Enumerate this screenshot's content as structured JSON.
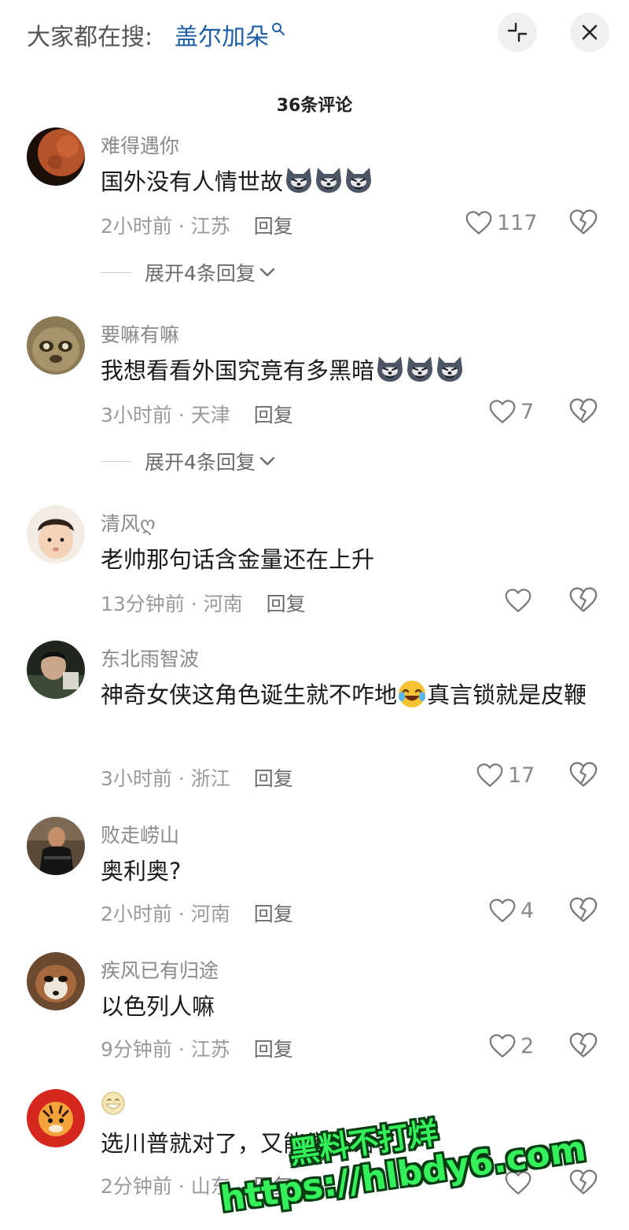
{
  "top_bar": {
    "hot_search_prefix": "大家都在搜:",
    "hot_search_term": "盖尔加朵"
  },
  "comment_count": "36条评论",
  "comments": [
    {
      "username": "难得遇你",
      "content": "国外没有人情世故",
      "emoji_count": 3,
      "time": "2小时前",
      "location": "江苏",
      "reply": "回复",
      "likes": "117",
      "expand": "展开4条回复"
    },
    {
      "username": "要嘛有嘛",
      "content": "我想看看外国究竟有多黑暗",
      "emoji_count": 3,
      "time": "3小时前",
      "location": "天津",
      "reply": "回复",
      "likes": "7",
      "expand": "展开4条回复"
    },
    {
      "username": "清风ღ",
      "content": "老帅那句话含金量还在上升",
      "time": "13分钟前",
      "location": "河南",
      "reply": "回复",
      "likes": ""
    },
    {
      "username": "东北雨智波",
      "content_before_emoji": "神奇女侠这角色诞生就不咋地",
      "content_after_emoji": "真言锁就是皮鞭",
      "time": "3小时前",
      "location": "浙江",
      "reply": "回复",
      "likes": "17"
    },
    {
      "username": "败走崂山",
      "content": "奥利奥?",
      "time": "2小时前",
      "location": "河南",
      "reply": "回复",
      "likes": "4"
    },
    {
      "username": "疾风已有归途",
      "content": "以色列人嘛",
      "time": "9分钟前",
      "location": "江苏",
      "reply": "回复",
      "likes": "2"
    },
    {
      "username": "",
      "username_emoji": "grinning-face",
      "content": "选川普就对了，又能学外语了",
      "time": "2分钟前",
      "location": "山东",
      "reply": "回复",
      "likes": ""
    }
  ],
  "icons": {
    "collapse": "collapse-icon",
    "close": "close-icon",
    "like": "heart-outline-icon",
    "dislike": "broken-heart-icon",
    "expand": "chevron-down-icon",
    "search": "search-icon"
  },
  "watermark": {
    "line1": "黑料不打烊",
    "line2": "https://hlbdy6.com"
  },
  "colors": {
    "hot_term": "#1f5fa8",
    "meta_gray": "#9a9a9a",
    "watermark_green": "#34f05a"
  }
}
